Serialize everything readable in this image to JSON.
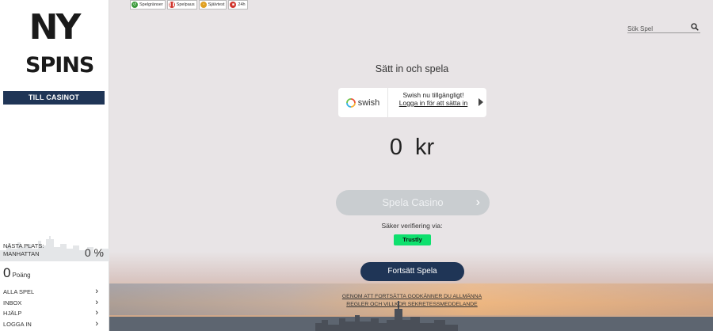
{
  "sidebar": {
    "logo_top": "NY",
    "logo_bottom": "SPINS",
    "casino_button": "TILL CASINOT",
    "next_place_label_1": "NÄSTA PLATS:",
    "next_place_label_2": "MANHATTAN",
    "next_place_percent": "0 %",
    "points_value": "0",
    "points_label": "Poäng",
    "nav": [
      {
        "label": "ALLA SPEL"
      },
      {
        "label": "INBOX"
      },
      {
        "label": "HJÄLP"
      },
      {
        "label": "LOGGA IN"
      }
    ]
  },
  "topbar": {
    "chips": [
      {
        "label": "Spelgränser",
        "icon": "limit-icon",
        "color": "#3a9a3a"
      },
      {
        "label": "Spelpaus",
        "icon": "pause-icon",
        "color": "#d0342c"
      },
      {
        "label": "Självtest",
        "icon": "gauge-icon",
        "color": "#e0a020"
      },
      {
        "label": "24h",
        "icon": "stop-icon",
        "color": "#d0342c"
      }
    ]
  },
  "search": {
    "placeholder": "Sök Spel"
  },
  "main": {
    "title": "Sätt in och spela",
    "swish": {
      "brand": "swish",
      "line1": "Swish nu tillgängligt!",
      "line2": "Logga in för att sätta in"
    },
    "amount": "0 kr",
    "play_button": "Spela Casino",
    "verify_text": "Säker verifiering via:",
    "trustly": "Trustly",
    "continue_button": "Fortsätt Spela",
    "terms": "GENOM ATT FORTSÄTTA GODKÄNNER DU ALLMÄNNA REGLER OCH VILLKOR SEKRETESSMEDDELANDE"
  },
  "colors": {
    "navy": "#1f3556",
    "trustly_green": "#0ee06e",
    "background": "#e8e4e6"
  }
}
